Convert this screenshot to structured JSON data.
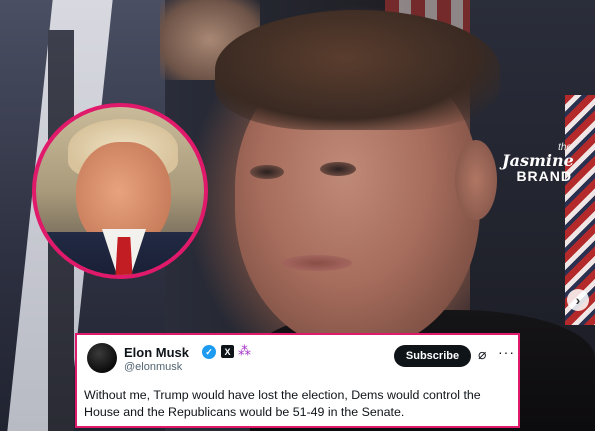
{
  "watermark": {
    "the": "the",
    "jasmine": "Jasmine",
    "brand": "BRAND"
  },
  "carousel": {
    "next_icon": "chevron-right-icon",
    "next_glyph": "›"
  },
  "tweet": {
    "author_name": "Elon Musk",
    "handle": "@elonmusk",
    "subscribe_label": "Subscribe",
    "more_glyph": "···",
    "grok_glyph": "⌀",
    "text": "Without me, Trump would have lost the election, Dems would control the House and the Republicans would be 51-49 in the Senate.",
    "icons": [
      "verified-badge-icon",
      "x-logo-icon",
      "community-icon",
      "grok-icon",
      "more-options-icon"
    ]
  },
  "colors": {
    "accent_pink": "#e0196b",
    "verified_blue": "#1d9bf0",
    "subscribe_bg": "#0f1419"
  }
}
